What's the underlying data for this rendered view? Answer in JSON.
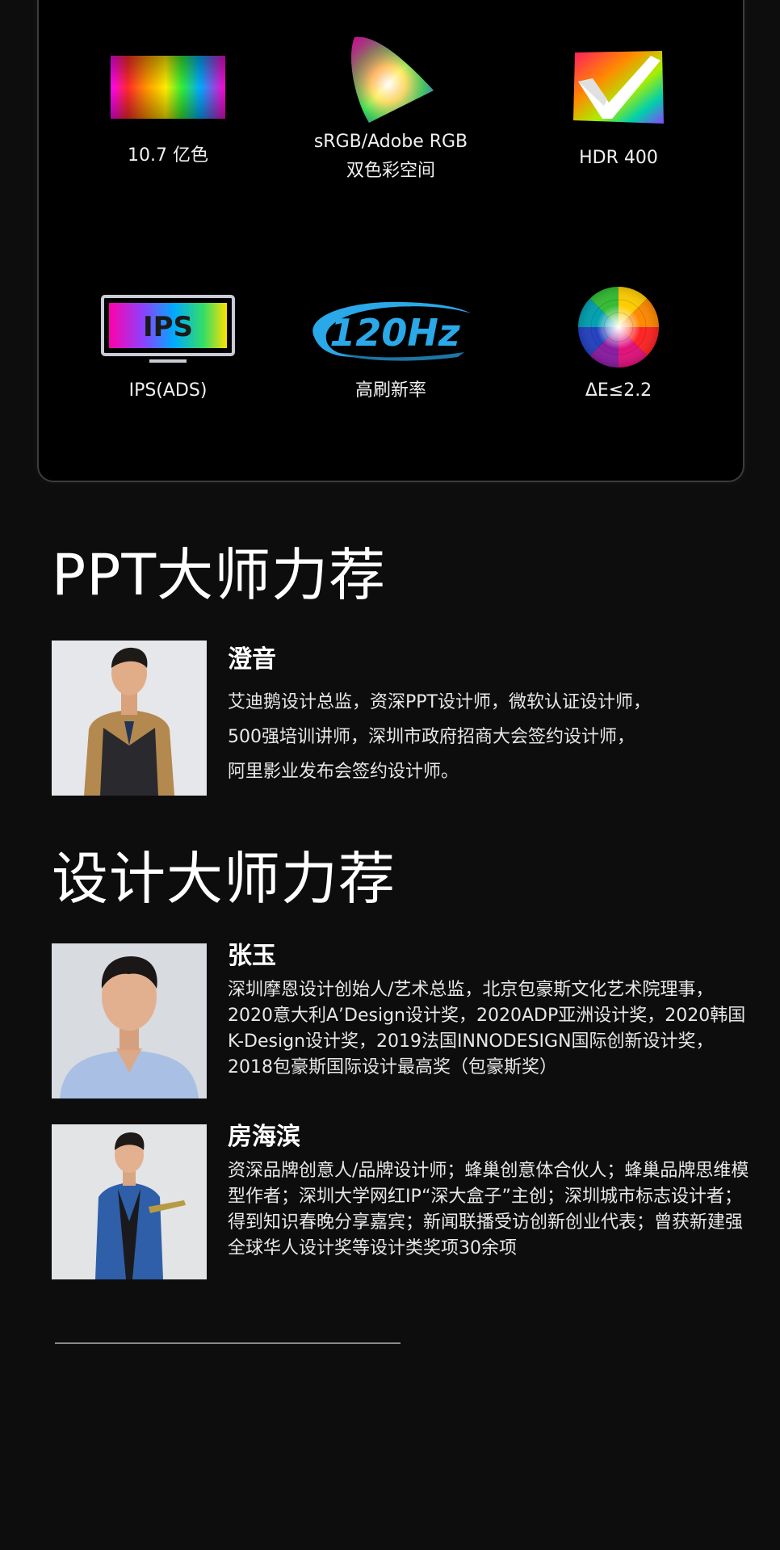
{
  "features": [
    {
      "icon": "color-spectrum-icon",
      "label": "10.7 亿色"
    },
    {
      "icon": "color-gamut-icon",
      "label": "sRGB/Adobe RGB\n双色彩空间"
    },
    {
      "icon": "hdr-icon",
      "label": "HDR 400"
    },
    {
      "icon": "ips-panel-icon",
      "label": "IPS(ADS)",
      "icon_text": "IPS"
    },
    {
      "icon": "refresh-rate-icon",
      "label": "高刷新率",
      "icon_text": "120Hz"
    },
    {
      "icon": "color-wheel-icon",
      "label": "ΔE≤2.2"
    }
  ],
  "sections": [
    {
      "title": "PPT大师力荐",
      "people": [
        {
          "name": "澄音",
          "desc": "艾迪鹅设计总监，资深PPT设计师，微软认证设计师，\n500强培训讲师，深圳市政府招商大会签约设计师，\n阿里影业发布会签约设计师。"
        }
      ]
    },
    {
      "title": "设计大师力荐",
      "people": [
        {
          "name": "张玉",
          "desc": "深圳摩恩设计创始人/艺术总监，北京包豪斯文化艺术院理事，2020意大利A’Design设计奖，2020ADP亚洲设计奖，2020韩国K-Design设计奖，2019法国INNODESIGN国际创新设计奖，2018包豪斯国际设计最高奖（包豪斯奖）"
        },
        {
          "name": "房海滨",
          "desc": "资深品牌创意人/品牌设计师；蜂巢创意体合伙人；蜂巢品牌思维模型作者；深圳大学网红IP“深大盒子”主创；深圳城市标志设计者；得到知识春晚分享嘉宾；新闻联播受访创新创业代表；曾获新建强全球华人设计奖等设计类奖项30余项"
        }
      ]
    }
  ],
  "colors": {
    "background": "#0d0d0d",
    "card": "#000000",
    "refresh_blue": "#2aa8e8"
  }
}
